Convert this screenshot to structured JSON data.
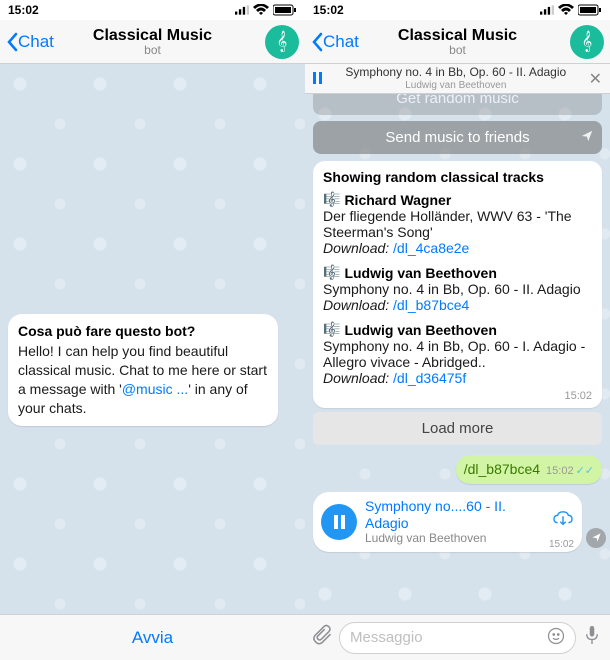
{
  "left": {
    "status": {
      "time": "15:02"
    },
    "nav": {
      "back": "Chat",
      "title": "Classical Music",
      "subtitle": "bot"
    },
    "intro": {
      "question": "Cosa può fare questo bot?",
      "body_pre": "Hello! I can help you find beautiful classical music. Chat to me here or start a message with '",
      "mention": "@music ...",
      "body_post": "' in any of your chats."
    },
    "start_label": "Avvia"
  },
  "right": {
    "status": {
      "time": "15:02"
    },
    "nav": {
      "back": "Chat",
      "title": "Classical Music",
      "subtitle": "bot"
    },
    "now_playing": {
      "track": "Symphony no. 4 in Bb, Op. 60 - II. Adagio",
      "artist": "Ludwig van Beethoven"
    },
    "kb": {
      "btn_random_partial": "Get random music",
      "btn_send": "Send music to friends"
    },
    "results": {
      "title": "Showing random classical tracks",
      "tracks": [
        {
          "composer": "Richard Wagner",
          "piece": "Der fliegende Holländer, WWV 63 - 'The Steerman's Song'",
          "dl_label": "Download:",
          "dl_link": "/dl_4ca8e2e"
        },
        {
          "composer": "Ludwig van Beethoven",
          "piece": "Symphony no. 4 in Bb, Op. 60 - II. Adagio",
          "dl_label": "Download:",
          "dl_link": "/dl_b87bce4"
        },
        {
          "composer": "Ludwig van Beethoven",
          "piece": "Symphony no. 4 in Bb, Op. 60 - I. Adagio - Allegro vivace - Abridged..",
          "dl_label": "Download:",
          "dl_link": "/dl_d36475f"
        }
      ],
      "time": "15:02",
      "load_more": "Load more"
    },
    "sent": {
      "text": "/dl_b87bce4",
      "time": "15:02"
    },
    "audio": {
      "title": "Symphony no....60 - II. Adagio",
      "artist": "Ludwig van Beethoven",
      "time": "15:02"
    },
    "input": {
      "placeholder": "Messaggio"
    }
  }
}
